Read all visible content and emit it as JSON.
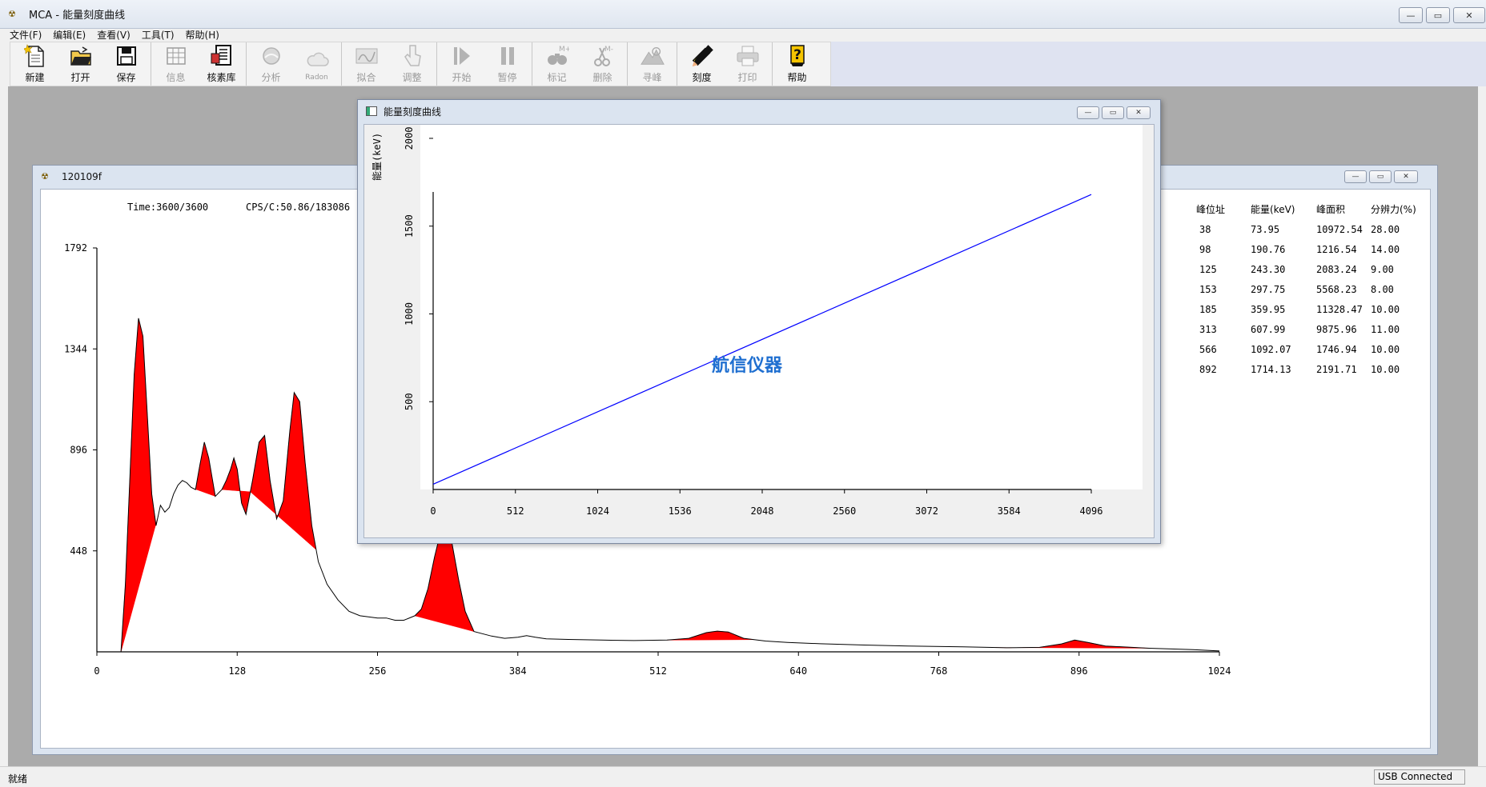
{
  "window": {
    "title": "MCA - 能量刻度曲线",
    "min_glyph": "—",
    "max_glyph": "▭",
    "close_glyph": "✕"
  },
  "menu": [
    {
      "label": "文件(F)"
    },
    {
      "label": "编辑(E)"
    },
    {
      "label": "查看(V)"
    },
    {
      "label": "工具(T)"
    },
    {
      "label": "帮助(H)"
    }
  ],
  "toolbar": {
    "new": "新建",
    "open": "打开",
    "save": "保存",
    "info": "信息",
    "nuclide_lib": "核素库",
    "analyze": "分析",
    "radon": "Radon",
    "fit": "拟合",
    "adjust": "调整",
    "start": "开始",
    "pause": "暂停",
    "mark": "标记",
    "delete": "删除",
    "mark_icon_text": "M+",
    "delete_icon_text": "M-",
    "find_peak": "寻峰",
    "calibrate": "刻度",
    "print": "打印",
    "help": "帮助"
  },
  "spectrum_window": {
    "title": "120109f",
    "time_text": "Time:3600/3600",
    "cps_text": "CPS/C:50.86/183086",
    "peak_table": {
      "headers": [
        "峰位址",
        "能量(keV)",
        "峰面积",
        "分辨力(%)"
      ],
      "rows": [
        [
          "38",
          "73.95",
          "10972.54",
          "28.00"
        ],
        [
          "98",
          "190.76",
          "1216.54",
          "14.00"
        ],
        [
          "125",
          "243.30",
          "2083.24",
          "9.00"
        ],
        [
          "153",
          "297.75",
          "5568.23",
          "8.00"
        ],
        [
          "185",
          "359.95",
          "11328.47",
          "10.00"
        ],
        [
          "313",
          "607.99",
          "9875.96",
          "11.00"
        ],
        [
          "566",
          "1092.07",
          "1746.94",
          "10.00"
        ],
        [
          "892",
          "1714.13",
          "2191.71",
          "10.00"
        ]
      ]
    }
  },
  "calibration_dialog": {
    "title": "能量刻度曲线",
    "watermark": "航信仪器",
    "line_color": "#0000ff",
    "watermark_color": "#1f6fd0"
  },
  "status": {
    "text": "就绪",
    "connection": "USB Connected"
  },
  "chart_data": [
    {
      "type": "area",
      "x_ticks": [
        0,
        128,
        256,
        384,
        512,
        640,
        768,
        896,
        1024
      ],
      "y_ticks": [
        448,
        896,
        1344,
        1792
      ],
      "xlim": [
        0,
        1024
      ],
      "ylim": [
        0,
        1792
      ],
      "fill_color": "#ff0000",
      "series": [
        {
          "x": [
            0,
            22,
            26,
            30,
            34,
            38,
            42,
            46,
            50,
            54,
            58,
            62,
            66,
            70,
            74,
            78,
            82,
            86,
            90,
            94,
            98,
            102,
            108,
            114,
            118,
            122,
            125,
            128,
            132,
            136,
            142,
            148,
            153,
            158,
            164,
            170,
            176,
            180,
            185,
            190,
            196,
            202,
            210,
            220,
            230,
            240,
            256,
            264,
            272,
            280,
            290,
            296,
            302,
            308,
            313,
            318,
            324,
            330,
            336,
            344,
            360,
            372,
            384,
            392,
            400,
            410,
            430,
            460,
            490,
            520,
            540,
            556,
            566,
            576,
            590,
            610,
            630,
            660,
            700,
            740,
            790,
            830,
            860,
            880,
            892,
            904,
            920,
            960,
            1000,
            1024
          ],
          "y": [
            0,
            0,
            300,
            760,
            1230,
            1480,
            1400,
            1050,
            700,
            560,
            650,
            620,
            640,
            700,
            740,
            760,
            750,
            730,
            720,
            830,
            930,
            860,
            690,
            720,
            760,
            810,
            860,
            810,
            660,
            610,
            760,
            930,
            960,
            760,
            590,
            670,
            980,
            1150,
            1110,
            840,
            560,
            400,
            300,
            230,
            180,
            160,
            150,
            150,
            140,
            140,
            160,
            190,
            280,
            420,
            520,
            540,
            480,
            320,
            180,
            90,
            70,
            60,
            65,
            72,
            65,
            58,
            55,
            52,
            50,
            52,
            60,
            85,
            92,
            88,
            60,
            48,
            42,
            36,
            30,
            26,
            22,
            18,
            20,
            35,
            52,
            42,
            26,
            16,
            10,
            4
          ]
        }
      ]
    },
    {
      "type": "line",
      "ylabel": "能量(keV)",
      "x_ticks": [
        0,
        512,
        1024,
        1536,
        2048,
        2560,
        3072,
        3584,
        4096
      ],
      "y_ticks": [
        500,
        1000,
        1500,
        2000
      ],
      "xlim": [
        0,
        4096
      ],
      "ylim": [
        0,
        2050
      ],
      "series": [
        {
          "x": [
            0,
            4096
          ],
          "y": [
            30,
            1680
          ]
        }
      ]
    }
  ]
}
